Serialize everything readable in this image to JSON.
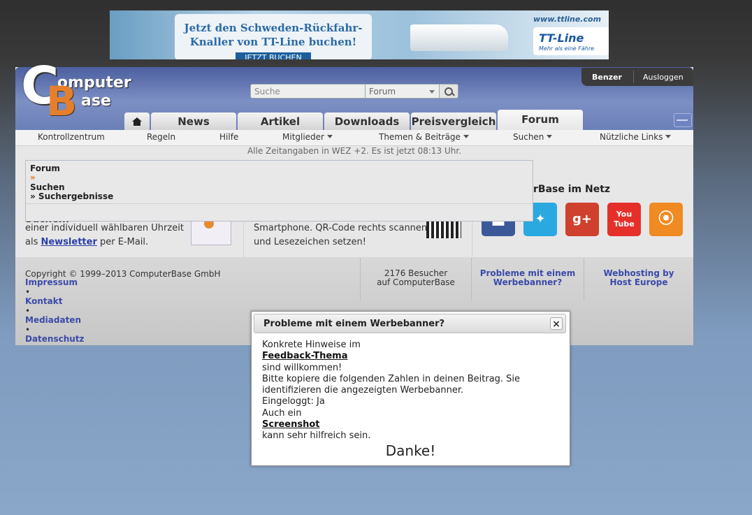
{
  "banner": {
    "headline_line1": "Jetzt den Schweden-Rückfahr-",
    "headline_line2": "Knaller von TT-Line buchen!",
    "cta": "JETZT BUCHEN",
    "url": "www.ttline.com",
    "logo_name": "TT-Line",
    "logo_tagline": "Mehr als eine Fähre"
  },
  "logo": {
    "word1": "omputer",
    "word2": "ase",
    "letter1": "C",
    "letter2": "B"
  },
  "user": {
    "name": "Benzer",
    "logout": "Ausloggen"
  },
  "search": {
    "placeholder": "Suche",
    "scope": "Forum"
  },
  "tabs": [
    {
      "label": "News"
    },
    {
      "label": "Artikel"
    },
    {
      "label": "Downloads"
    },
    {
      "label": "Preisvergleich"
    },
    {
      "label": "Forum"
    }
  ],
  "subnav": {
    "kontrollzentrum": "Kontrollzentrum",
    "regeln": "Regeln",
    "hilfe": "Hilfe",
    "mitglieder": "Mitglieder",
    "themen": "Themen & Beiträge",
    "suchen": "Suchen",
    "links": "Nützliche Links"
  },
  "time_info": "Alle Zeitangaben in WEZ +2. Es ist jetzt 08:13 Uhr.",
  "breadcrumb": {
    "item1": "Forum",
    "sep": "»",
    "item2": "Suchen",
    "item3": "» Suchergebnisse"
  },
  "content": {
    "search_heading": "Suchen:",
    "newsletter_line1": "einer individuell wählbaren Uhrzeit",
    "newsletter_pre": "als ",
    "newsletter_link": "Newsletter",
    "newsletter_post": " per E-Mail.",
    "qr_line1": "Smartphone. QR-Code rechts scannen",
    "qr_line2": "und Lesezeichen setzen!",
    "netz_heading": "rBase im Netz"
  },
  "footer": {
    "copyright": "Copyright © 1999–2013 ComputerBase GmbH",
    "links": [
      "Impressum",
      "Kontakt",
      "Mediadaten",
      "Datenschutz"
    ],
    "bullet": "•",
    "visitors_line1": "2176 Besucher",
    "visitors_line2": "auf ComputerBase",
    "ad_problem_line1": "Probleme mit einem",
    "ad_problem_line2": "Werbebanner?",
    "hosting_line1": "Webhosting by",
    "hosting_line2": "Host Europe"
  },
  "dialog": {
    "title": "Probleme mit einem Werbebanner?",
    "close": "×",
    "line1": "Konkrete Hinweise im",
    "link1": "Feedback-Thema",
    "line2": "sind willkommen!",
    "line3": "Bitte kopiere die folgenden Zahlen in deinen Beitrag. Sie",
    "line4": "identifizieren die angezeigten Werbebanner.",
    "line5": "Eingeloggt: Ja",
    "line6": "Auch ein",
    "link2": "Screenshot",
    "line7": "kann sehr hilfreich sein.",
    "thanks": "Danke!"
  },
  "colors": {
    "header_blue": "#6b7fb8",
    "accent_orange": "#e67f2b",
    "link_blue": "#3b4aa8",
    "twitter": "#2aa9e0",
    "googleplus": "#d0402f",
    "youtube": "#e5302a",
    "rss": "#f08a22",
    "facebook": "#3b5998"
  },
  "social": [
    {
      "name": "facebook-icon"
    },
    {
      "name": "twitter-icon"
    },
    {
      "name": "googleplus-icon",
      "glyph": "g+"
    },
    {
      "name": "youtube-icon",
      "glyph": "You Tube"
    },
    {
      "name": "rss-icon"
    }
  ]
}
